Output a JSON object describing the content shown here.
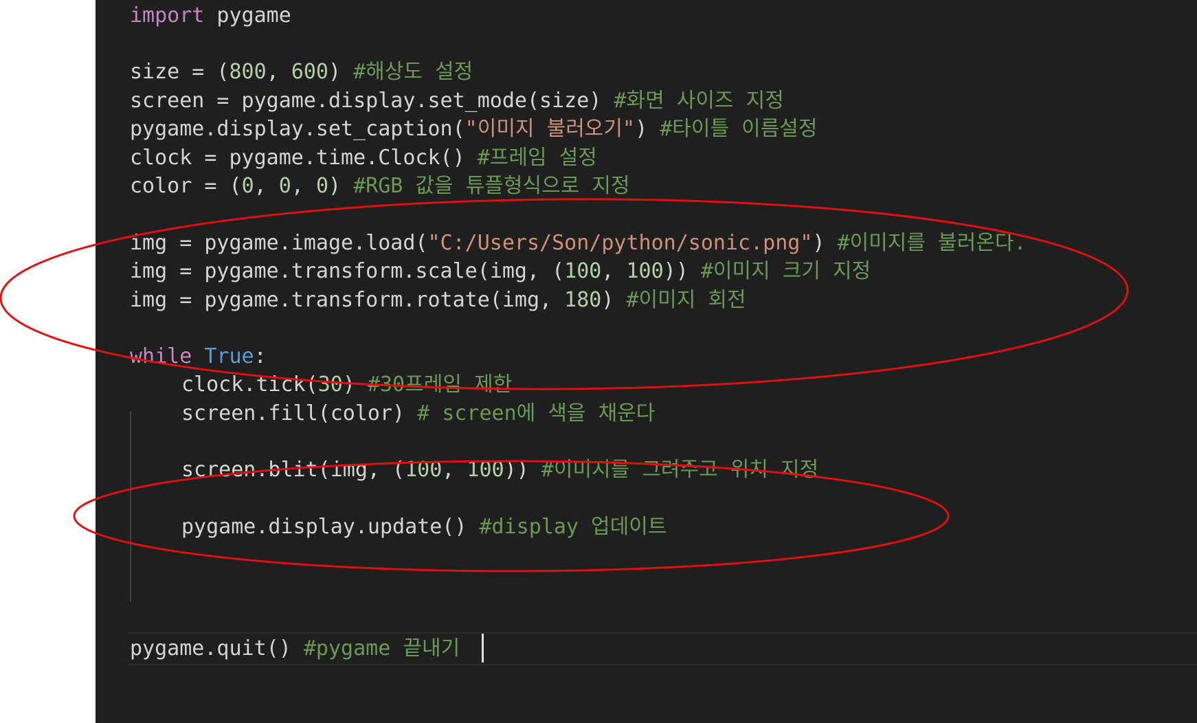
{
  "code": {
    "line1": {
      "kw": "import",
      "rest": " pygame"
    },
    "line3": {
      "a": "size = (",
      "n1": "800",
      "b": ", ",
      "n2": "600",
      "c": ") ",
      "cmt": "#해상도 설정"
    },
    "line4": {
      "a": "screen = pygame.display.set_mode(size) ",
      "cmt": "#화면 사이즈 지정"
    },
    "line5": {
      "a": "pygame.display.set_caption(",
      "str": "\"이미지 불러오기\"",
      "b": ") ",
      "cmt": "#타이틀 이름설정"
    },
    "line6": {
      "a": "clock = pygame.time.Clock() ",
      "cmt": "#프레임 설정"
    },
    "line7": {
      "a": "color = (",
      "n1": "0",
      "b": ", ",
      "n2": "0",
      "c": ", ",
      "n3": "0",
      "d": ") ",
      "cmt": "#RGB 값을 튜플형식으로 지정"
    },
    "line9": {
      "a": "img = pygame.image.load(",
      "str": "\"C:/Users/Son/python/sonic.png\"",
      "b": ") ",
      "cmt": "#이미지를 불러온다."
    },
    "line10": {
      "a": "img = pygame.transform.scale(img, (",
      "n1": "100",
      "b": ", ",
      "n2": "100",
      "c": ")) ",
      "cmt": "#이미지 크기 지정"
    },
    "line11": {
      "a": "img = pygame.transform.rotate(img, ",
      "n1": "180",
      "b": ") ",
      "cmt": "#이미지 회전"
    },
    "line13": {
      "kw": "while",
      "sp": " ",
      "const": "True",
      "b": ":"
    },
    "line14": {
      "a": "clock.tick(",
      "n1": "30",
      "b": ") ",
      "cmt": "#30프레임 제한"
    },
    "line15": {
      "a": "screen.fill(color) ",
      "cmt": "# screen에 색을 채운다"
    },
    "line17": {
      "a": "screen.blit(img, (",
      "n1": "100",
      "b": ", ",
      "n2": "100",
      "c": ")) ",
      "cmt": "#이미지를 그려주고 위치 지정"
    },
    "line19": {
      "a": "pygame.display.update() ",
      "cmt": "#display 업데이트"
    },
    "line21": {
      "a": "pygame.quit() ",
      "cmt": "#pygame 끝내기"
    }
  },
  "colors": {
    "editor_bg": "#1f1f1f",
    "keyword": "#c586c0",
    "constant": "#569cd6",
    "number": "#b5cea8",
    "string": "#ce9178",
    "comment": "#6a9955",
    "annotation_ellipse": "#e01010"
  }
}
